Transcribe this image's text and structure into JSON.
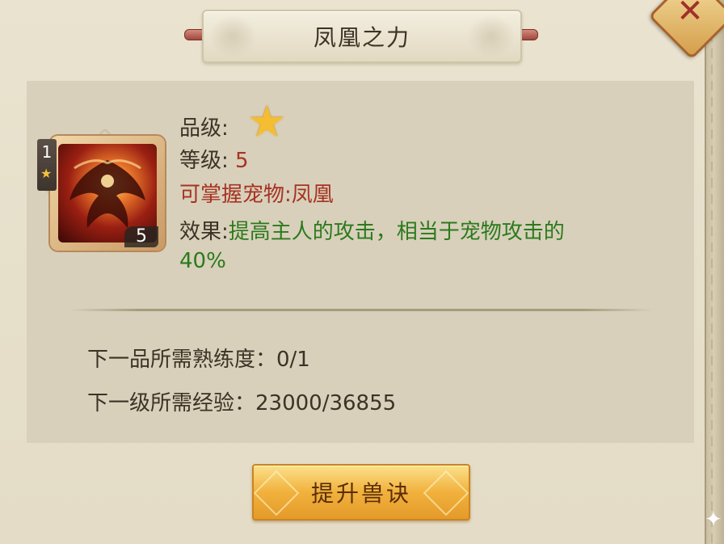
{
  "dialog": {
    "title": "凤凰之力",
    "close_glyph": "✕"
  },
  "skill": {
    "icon_name": "phoenix-icon",
    "rank": "1",
    "level_badge": "5",
    "grade_label": "品级:",
    "grade_icon": "star-icon",
    "level_label": "等级:",
    "level_value": "5",
    "pet_label": "可掌握宠物:",
    "pet_value": "凤凰",
    "effect_label": "效果:",
    "effect_value_line1": "提高主人的攻击，相当于宠物攻击的",
    "effect_value_line2": "40%"
  },
  "requirements": {
    "next_grade": "下一品所需熟练度：0/1",
    "next_level": "下一级所需经验：23000/36855"
  },
  "actions": {
    "upgrade_label": "提升兽诀"
  },
  "colors": {
    "panel_bg": "#e6dfca",
    "content_bg": "#d8d0bb",
    "red_text": "#a63322",
    "green_text": "#2b7a1c",
    "button_gold": "#f1b13c"
  }
}
